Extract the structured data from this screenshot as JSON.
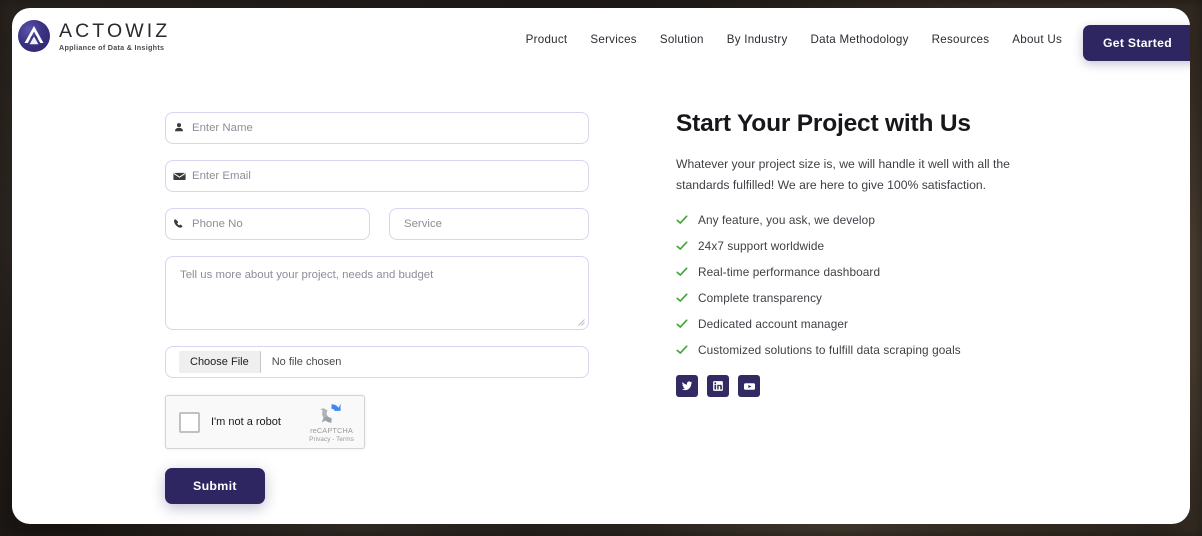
{
  "brand": {
    "logo_word": "ACTOWIZ",
    "logo_tagline": "Appliance of Data & Insights",
    "primary_color": "#2e2661",
    "check_color": "#3fa535",
    "border_color": "#d8d5ef"
  },
  "header": {
    "nav_items": [
      {
        "label": "Product"
      },
      {
        "label": "Services"
      },
      {
        "label": "Solution"
      },
      {
        "label": "By Industry"
      },
      {
        "label": "Data Methodology"
      },
      {
        "label": "Resources"
      },
      {
        "label": "About Us"
      }
    ],
    "cta_label": "Get Started"
  },
  "form": {
    "name_placeholder": "Enter Name",
    "name_value": "",
    "email_placeholder": "Enter Email",
    "email_value": "",
    "phone_placeholder": "Phone No",
    "phone_value": "",
    "service_placeholder": "Service",
    "service_value": "",
    "message_placeholder": "Tell us more about your project, needs and budget",
    "message_value": "",
    "file_button_label": "Choose File",
    "file_status": "No file chosen",
    "submit_label": "Submit"
  },
  "recaptcha": {
    "label": "I'm not a robot",
    "brand_name": "reCAPTCHA",
    "legal": "Privacy - Terms",
    "checked": false
  },
  "info": {
    "title": "Start Your Project with Us",
    "description": "Whatever your project size is, we will handle it well with all the standards fulfilled! We are here to give 100% satisfaction.",
    "benefits": [
      {
        "text": "Any feature, you ask, we develop"
      },
      {
        "text": "24x7 support worldwide"
      },
      {
        "text": "Real-time performance dashboard"
      },
      {
        "text": "Complete transparency"
      },
      {
        "text": "Dedicated account manager"
      },
      {
        "text": "Customized solutions to fulfill data scraping goals"
      }
    ],
    "socials": [
      {
        "name": "twitter"
      },
      {
        "name": "linkedin"
      },
      {
        "name": "youtube"
      }
    ]
  }
}
